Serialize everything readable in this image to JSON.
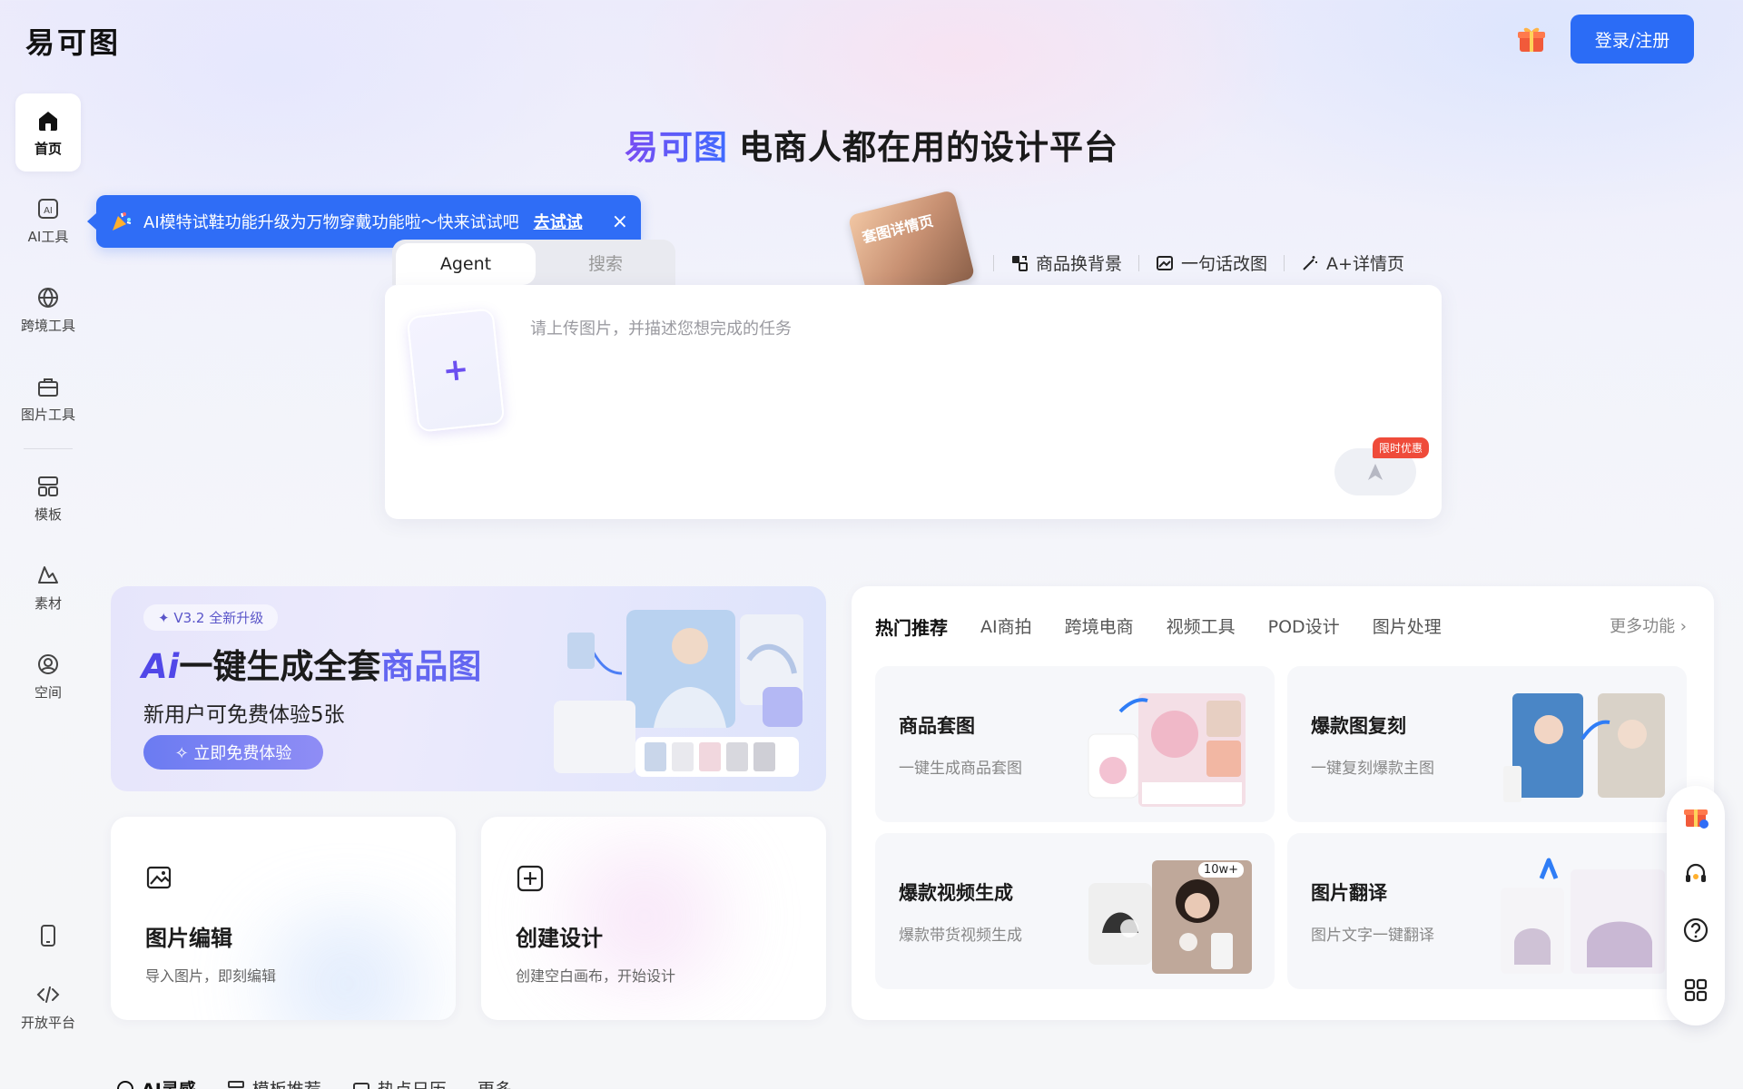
{
  "header": {
    "logo_chars": [
      "易",
      "可",
      "图"
    ],
    "login_label": "登录/注册"
  },
  "sidebar": {
    "items": [
      {
        "label": "首页",
        "icon": "home-icon"
      },
      {
        "label": "AI工具",
        "icon": "ai-icon"
      },
      {
        "label": "跨境工具",
        "icon": "globe-icon"
      },
      {
        "label": "图片工具",
        "icon": "toolbox-icon"
      },
      {
        "label": "模板",
        "icon": "template-icon"
      },
      {
        "label": "素材",
        "icon": "shapes-icon"
      },
      {
        "label": "空间",
        "icon": "user-circle-icon"
      },
      {
        "label": "",
        "icon": "mobile-icon"
      },
      {
        "label": "开放平台",
        "icon": "code-icon"
      }
    ]
  },
  "hero": {
    "brand": "易可图",
    "title": "电商人都在用的设计平台"
  },
  "notice": {
    "text": "AI模特试鞋功能升级为万物穿戴功能啦～快来试试吧",
    "link": "去试试",
    "close": "×"
  },
  "mode_tabs": [
    "Agent",
    "搜索"
  ],
  "card_image_label": "套图详情页",
  "quick_functions": [
    "商品换背景",
    "一句话改图",
    "A+详情页"
  ],
  "input": {
    "upload_symbol": "+",
    "placeholder": "请上传图片，并描述您想完成的任务",
    "promo_tag": "限时优惠"
  },
  "banner": {
    "version_badge": "✦ V3.2 全新升级",
    "title_ai": "Ai",
    "title_main": "一键生成全套",
    "title_grad": "商品图",
    "subtitle": "新用户可免费体验5张",
    "button": "✧ 立即免费体验"
  },
  "mini_cards": [
    {
      "title": "图片编辑",
      "desc": "导入图片，即刻编辑",
      "icon": "image-edit-icon"
    },
    {
      "title": "创建设计",
      "desc": "创建空白画布，开始设计",
      "icon": "plus-square-icon"
    }
  ],
  "hot": {
    "tabs": [
      "热门推荐",
      "AI商拍",
      "跨境电商",
      "视频工具",
      "POD设计",
      "图片处理"
    ],
    "more": "更多功能 ›",
    "features": [
      {
        "title": "商品套图",
        "desc": "一键生成商品套图"
      },
      {
        "title": "爆款图复刻",
        "desc": "一键复刻爆款主图"
      },
      {
        "title": "爆款视频生成",
        "desc": "爆款带货视频生成"
      },
      {
        "title": "图片翻译",
        "desc": "图片文字一键翻译"
      }
    ],
    "video_badge": "10w+"
  },
  "bottom_tabs": [
    "AI灵感",
    "模板推荐",
    "热点日历",
    "更多"
  ],
  "colors": {
    "primary": "#2b6cf6",
    "brand_purple": "#6b4ff0",
    "promo_red": "#ef4b3a"
  }
}
